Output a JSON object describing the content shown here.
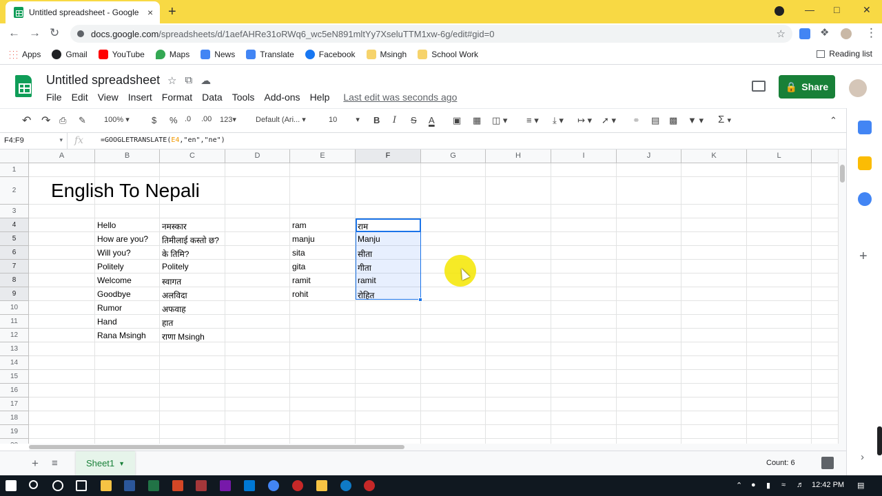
{
  "browser": {
    "tab_title": "Untitled spreadsheet - Google Sh",
    "tab_close": "×",
    "new_tab": "+",
    "url_host": "docs.google.com",
    "url_path": "/spreadsheets/d/1aefAHRe31oRWq6_wc5eN891mltYy7XseluTTM1xw-6g/edit#gid=0",
    "bookmarks": [
      {
        "label": "Apps",
        "color": "#5f6368"
      },
      {
        "label": "Gmail",
        "color": "#202124"
      },
      {
        "label": "YouTube",
        "color": "#ff0000"
      },
      {
        "label": "Maps",
        "color": "#34a853"
      },
      {
        "label": "News",
        "color": "#4285f4"
      },
      {
        "label": "Translate",
        "color": "#4285f4"
      },
      {
        "label": "Facebook",
        "color": "#1877f2"
      },
      {
        "label": "Msingh",
        "color": "#f6d36b"
      },
      {
        "label": "School Work",
        "color": "#f6d36b"
      }
    ],
    "reading_list": "Reading list"
  },
  "doc": {
    "title": "Untitled spreadsheet",
    "menu": [
      "File",
      "Edit",
      "View",
      "Insert",
      "Format",
      "Data",
      "Tools",
      "Add-ons",
      "Help"
    ],
    "last_edit": "Last edit was seconds ago",
    "share_label": "Share"
  },
  "toolbar": {
    "zoom": "100%",
    "currency": "$",
    "percent": "%",
    "dec_decrease": ".0",
    "dec_increase": ".00",
    "more_formats": "123",
    "font": "Default (Ari...",
    "font_size": "10",
    "bold": "B",
    "italic": "I",
    "strike": "S",
    "text_color": "A",
    "sum": "Σ"
  },
  "formula_bar": {
    "name_box": "F4:F9",
    "fx": "fx",
    "formula_prefix": "=GOOGLETRANSLATE(",
    "formula_ref": "E4",
    "formula_suffix": ",\"en\",\"ne\")"
  },
  "grid": {
    "columns": [
      "A",
      "B",
      "C",
      "D",
      "E",
      "F",
      "G",
      "H",
      "I",
      "J",
      "K",
      "L"
    ],
    "rows": [
      "1",
      "2",
      "3",
      "4",
      "5",
      "6",
      "7",
      "8",
      "9",
      "10",
      "11",
      "12",
      "13",
      "14",
      "15",
      "16",
      "17",
      "18",
      "19",
      "20"
    ],
    "title": "English To Nepali",
    "col_b": [
      "Hello",
      "How are you?",
      "Will you?",
      "Politely",
      "Welcome",
      "Goodbye",
      "Rumor",
      "Hand",
      "Rana Msingh"
    ],
    "col_c": [
      "नमस्कार",
      "तिमीलाई कस्तो छ?",
      "के तिमि?",
      "Politely",
      "स्वागत",
      "अलविदा",
      "अफवाह",
      "हात",
      "राणा Msingh"
    ],
    "col_e": [
      "ram",
      "manju",
      "sita",
      "gita",
      "ramit",
      "rohit"
    ],
    "col_f": [
      "राम",
      "Manju",
      "सीता",
      "गीता",
      "ramit",
      "रोहित"
    ]
  },
  "sheets": {
    "add": "+",
    "list": "≡",
    "tab_name": "Sheet1",
    "count": "Count: 6"
  },
  "taskbar": {
    "time": "12:42 PM"
  }
}
